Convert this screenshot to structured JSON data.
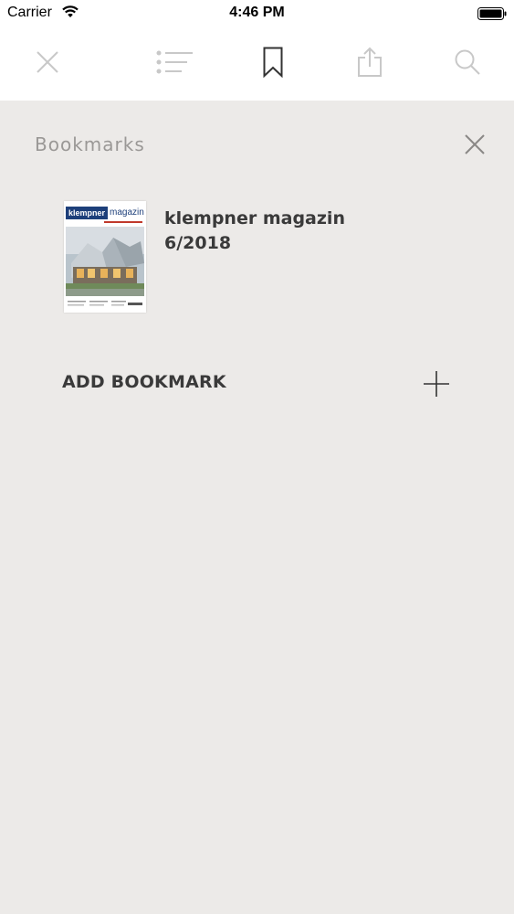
{
  "status_bar": {
    "carrier": "Carrier",
    "time": "4:46 PM",
    "icons": [
      "wifi-icon",
      "battery-icon"
    ]
  },
  "toolbar": {
    "items": [
      {
        "name": "close",
        "icon": "close-icon"
      },
      {
        "name": "contents",
        "icon": "list-icon"
      },
      {
        "name": "bookmarks",
        "icon": "bookmark-icon",
        "active": true
      },
      {
        "name": "share",
        "icon": "share-icon"
      },
      {
        "name": "search",
        "icon": "search-icon"
      }
    ],
    "active_color": "#333333",
    "inactive_color": "#c8c8c8"
  },
  "bookmarks_panel": {
    "title": "Bookmarks",
    "items": [
      {
        "title_line1": "klempner magazin",
        "title_line2": "6/2018",
        "cover": {
          "masthead_left": "klempner",
          "masthead_right": "magazin"
        }
      }
    ],
    "add_label": "ADD BOOKMARK"
  },
  "colors": {
    "panel_background": "#eceae8",
    "toolbar_background": "#ffffff",
    "title_gray": "#9a9896",
    "text_dark": "#3a3a3a",
    "cover_blue": "#1d3f7a"
  }
}
